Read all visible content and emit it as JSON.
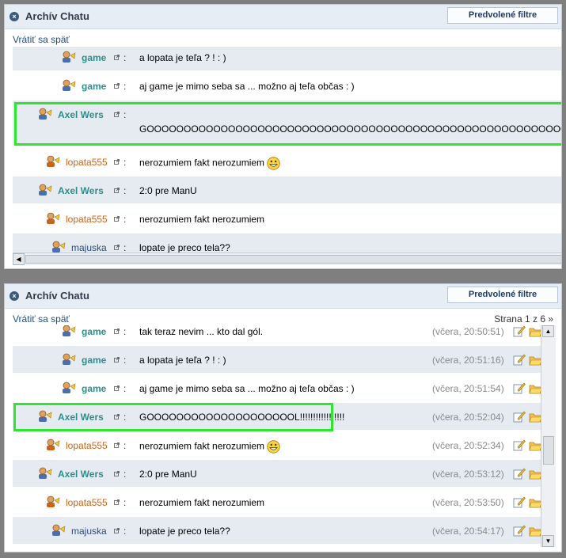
{
  "panels": [
    {
      "title": "Archív Chatu",
      "filter_button": "Predvolené filtre",
      "back_link": "Vrátiť sa späť",
      "rows": [
        {
          "nick": "game",
          "message": "a lopata je teľa ? ! : )"
        },
        {
          "nick": "game",
          "message": "aj game je mimo seba sa ... možno aj teľa občas : )"
        },
        {
          "nick": "Axel Wers",
          "message": "GOOOOOOOOOOOOOOOOOOOOOOOOOOOOOOOOOOOOOOOOOOOOOOOOOOOOOOOOO"
        },
        {
          "nick": "lopata555",
          "message": "nerozumiem fakt nerozumiem"
        },
        {
          "nick": "Axel Wers",
          "message": "2:0 pre ManU"
        },
        {
          "nick": "lopata555",
          "message": "nerozumiem fakt nerozumiem"
        },
        {
          "nick": "majuska",
          "message": "lopate je preco tela??"
        }
      ]
    },
    {
      "title": "Archív Chatu",
      "filter_button": "Predvolené filtre",
      "back_link": "Vrátiť sa späť",
      "pager": "Strana 1 z 6 »",
      "rows": [
        {
          "nick": "game",
          "message": "tak teraz nevim ... kto dal gól.",
          "time": "(včera, 20:50:51)"
        },
        {
          "nick": "game",
          "message": "a lopata je teľa ? ! : )",
          "time": "(včera, 20:51:16)"
        },
        {
          "nick": "game",
          "message": "aj game je mimo seba sa ... možno aj teľa občas : )",
          "time": "(včera, 20:51:54)"
        },
        {
          "nick": "Axel Wers",
          "message": "GOOOOOOOOOOOOOOOOOOOOL!!!!!!!!!!!!!!!!!",
          "time": "(včera, 20:52:04)"
        },
        {
          "nick": "lopata555",
          "message": "nerozumiem fakt nerozumiem",
          "time": "(včera, 20:52:34)"
        },
        {
          "nick": "Axel Wers",
          "message": "2:0 pre ManU",
          "time": "(včera, 20:53:12)"
        },
        {
          "nick": "lopata555",
          "message": "nerozumiem fakt nerozumiem",
          "time": "(včera, 20:53:50)"
        },
        {
          "nick": "majuska",
          "message": "lopate je preco tela??",
          "time": "(včera, 20:54:17)"
        }
      ]
    }
  ],
  "colon": ":",
  "colors": {
    "nick_game": "#2f8d8a",
    "nick_axel": "#2f8d8a",
    "nick_lopata": "#c9641a",
    "nick_majuska": "#2b4c7e",
    "row_alt_bg": "#e6ebf2",
    "highlight_border": "#2ee62e"
  }
}
